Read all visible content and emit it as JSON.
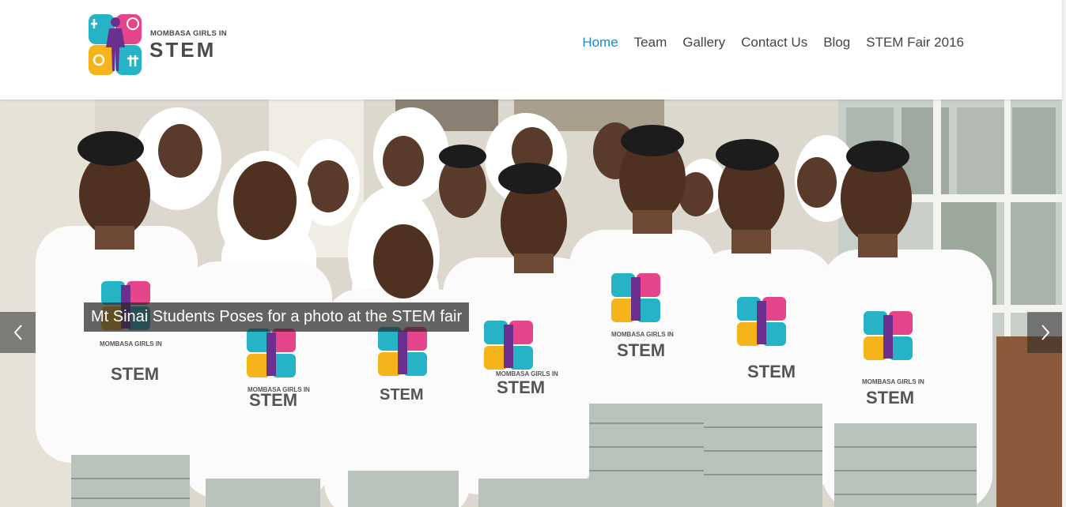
{
  "brand": {
    "line1": "MOMBASA GIRLS IN",
    "line2": "STEM"
  },
  "nav": {
    "items": [
      {
        "label": "Home",
        "active": true
      },
      {
        "label": "Team",
        "active": false
      },
      {
        "label": "Gallery",
        "active": false
      },
      {
        "label": "Contact Us",
        "active": false
      },
      {
        "label": "Blog",
        "active": false
      },
      {
        "label": "STEM Fair 2016",
        "active": false
      }
    ]
  },
  "slider": {
    "caption": "Mt Sinai Students Poses for a photo at the STEM fair",
    "prev_icon": "chevron-left-icon",
    "next_icon": "chevron-right-icon",
    "tshirt_line1": "MOMBASA GIRLS IN",
    "tshirt_line2": "STEM"
  },
  "colors": {
    "active_link": "#1e8bc3",
    "nav_text": "#444444",
    "logo_teal": "#27b3c6",
    "logo_purple": "#6b2f8f",
    "logo_yellow": "#f4b41a",
    "logo_pink": "#e5458b"
  }
}
